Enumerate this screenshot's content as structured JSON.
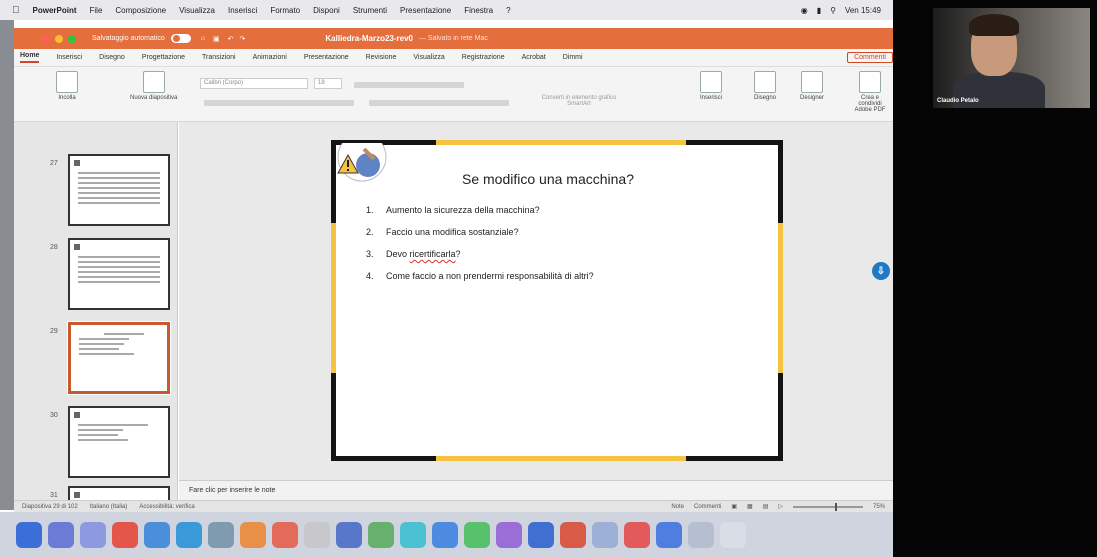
{
  "menubar": {
    "app": "PowerPoint",
    "items": [
      "File",
      "Composizione",
      "Visualizza",
      "Inserisci",
      "Formato",
      "Disponi",
      "Strumenti",
      "Presentazione",
      "Finestra",
      "?"
    ],
    "clock": "Ven 15:49"
  },
  "titlebar": {
    "autosave": "Salvataggio automatico",
    "document": "Kalliedra-Marzo23-rev0",
    "saved": "— Salvato in rete Mac"
  },
  "ribbon": {
    "tabs": [
      "Home",
      "Inserisci",
      "Disegno",
      "Progettazione",
      "Transizioni",
      "Animazioni",
      "Presentazione",
      "Revisione",
      "Visualizza",
      "Registrazione",
      "Acrobat",
      "Dimmi"
    ],
    "comment_button": "Commenti",
    "paste_label": "Incolla",
    "new_slide_label": "Nuova diapositiva",
    "font_name": "Calibri (Corpo)",
    "font_size": "18",
    "convert_label": "Converti in elemento grafico SmartArt",
    "insert_label": "Inserisci",
    "draw_label": "Disegno",
    "designer_label": "Designer",
    "pdf_label": "Crea e condividi Adobe PDF"
  },
  "thumbnails": [
    {
      "num": "27"
    },
    {
      "num": "28"
    },
    {
      "num": "29",
      "selected": true
    },
    {
      "num": "30"
    },
    {
      "num": "31"
    }
  ],
  "slide": {
    "title": "Se modifico una macchina?",
    "items": [
      {
        "num": "1.",
        "text": "Aumento la sicurezza della macchina?"
      },
      {
        "num": "2.",
        "text": "Faccio una modifica sostanziale?"
      },
      {
        "num": "3.",
        "prefix": "Devo ",
        "underlined": "ricertificarla",
        "suffix": "?"
      },
      {
        "num": "4.",
        "text": "Come faccio a non prendermi responsabilità di altri?"
      }
    ]
  },
  "notes_placeholder": "Fare clic per inserire le note",
  "status": {
    "slide_counter": "Diapositiva 29 di 102",
    "language": "Italiano (Italia)",
    "accessibility": "Accessibilità: verifica",
    "notes": "Note",
    "comments": "Commenti",
    "zoom": "75%"
  },
  "video": {
    "name": "Claudio Petalo"
  },
  "colors": {
    "accent": "#e46e3c",
    "slide_bar": "#f5c242"
  }
}
